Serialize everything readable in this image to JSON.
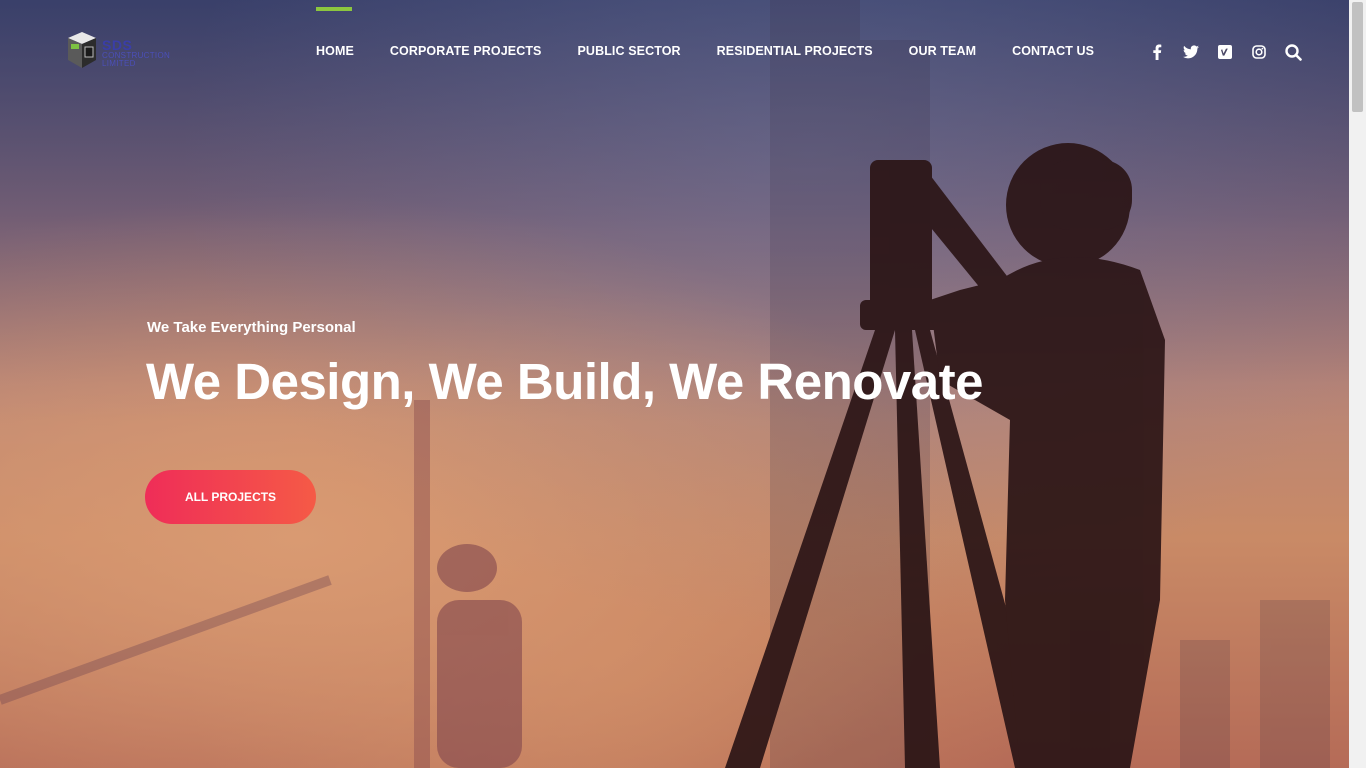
{
  "brand": {
    "name": "SDS",
    "subtitle": "CONSTRUCTION LIMITED"
  },
  "nav": {
    "items": [
      {
        "label": "HOME"
      },
      {
        "label": "CORPORATE PROJECTS"
      },
      {
        "label": "PUBLIC SECTOR"
      },
      {
        "label": "RESIDENTIAL PROJECTS"
      },
      {
        "label": "OUR TEAM"
      },
      {
        "label": "CONTACT US"
      }
    ],
    "active_index": 0,
    "active_color": "#8cc63f"
  },
  "social": {
    "icons": [
      "facebook-icon",
      "twitter-icon",
      "vimeo-icon",
      "instagram-icon",
      "search-icon"
    ]
  },
  "hero": {
    "tagline": "We Take Everything Personal",
    "headline": "We Design, We Build, We Renovate",
    "cta_label": "ALL PROJECTS",
    "cta_gradient": [
      "#ef2d58",
      "#f55a46"
    ]
  }
}
